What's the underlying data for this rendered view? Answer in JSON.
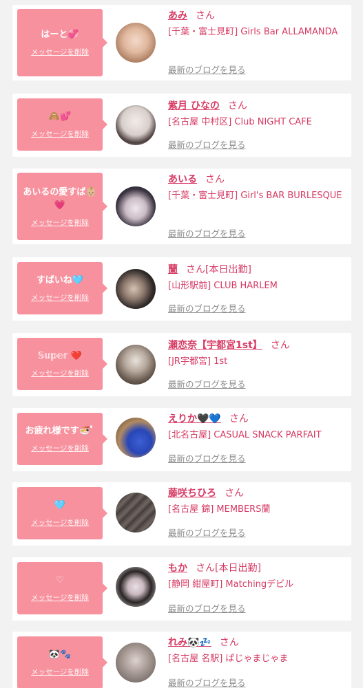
{
  "delete_label": "メッセージを削除",
  "blog_label": "最新のブログを見る",
  "san_label": "さん",
  "cards": [
    {
      "message": "はーと💞",
      "name": "あみ",
      "extra": "",
      "shop": "[千葉・富士見町] Girls Bar ALLAMANDA",
      "avatar": "#c9a48c"
    },
    {
      "message": "🙈💕",
      "name": "紫月 ひなの",
      "extra": "",
      "shop": "[名古屋 中村区] Club NIGHT CAFE",
      "avatar": "#5a4a48"
    },
    {
      "message": "あいるの愛すば👶🏼💗",
      "name": "あいる",
      "extra": "",
      "shop": "[千葉・富士見町] Girl's BAR BURLESQUE",
      "avatar": "#3a3340"
    },
    {
      "message": "すばいね🩵",
      "name": "蘭",
      "extra": "[本日出勤]",
      "shop": "[山形駅前] CLUB HARLEM",
      "avatar": "#2f2a28"
    },
    {
      "message": "𝕊𝕦𝕡𝕖𝕣 ❤️",
      "name": "瀬恋奈【宇都宮1st】",
      "extra": "",
      "shop": "[JR宇都宮] 1st",
      "avatar": "#6b5d52"
    },
    {
      "message": "お疲れ様です🍜ﾟ",
      "name": "えりか🖤💙",
      "extra": "",
      "shop": "[北名古屋] CASUAL SNACK PARFAIT",
      "avatar": "#3d5fd1"
    },
    {
      "message": "🩵",
      "name": "藤咲ちひろ",
      "extra": "",
      "shop": "[名古屋 錦] MEMBERS蘭",
      "avatar": "#5b5350"
    },
    {
      "message": "♡",
      "name": "もか",
      "extra": "[本日出勤]",
      "shop": "[静岡 紺屋町] Matchingデビル",
      "avatar": "#2b2626"
    },
    {
      "message": "🐼🐾",
      "name": "れみ🐼💤",
      "extra": "",
      "shop": "[名古屋 名駅] ぱじゃまじゃま",
      "avatar": "#8a7f7a"
    }
  ]
}
